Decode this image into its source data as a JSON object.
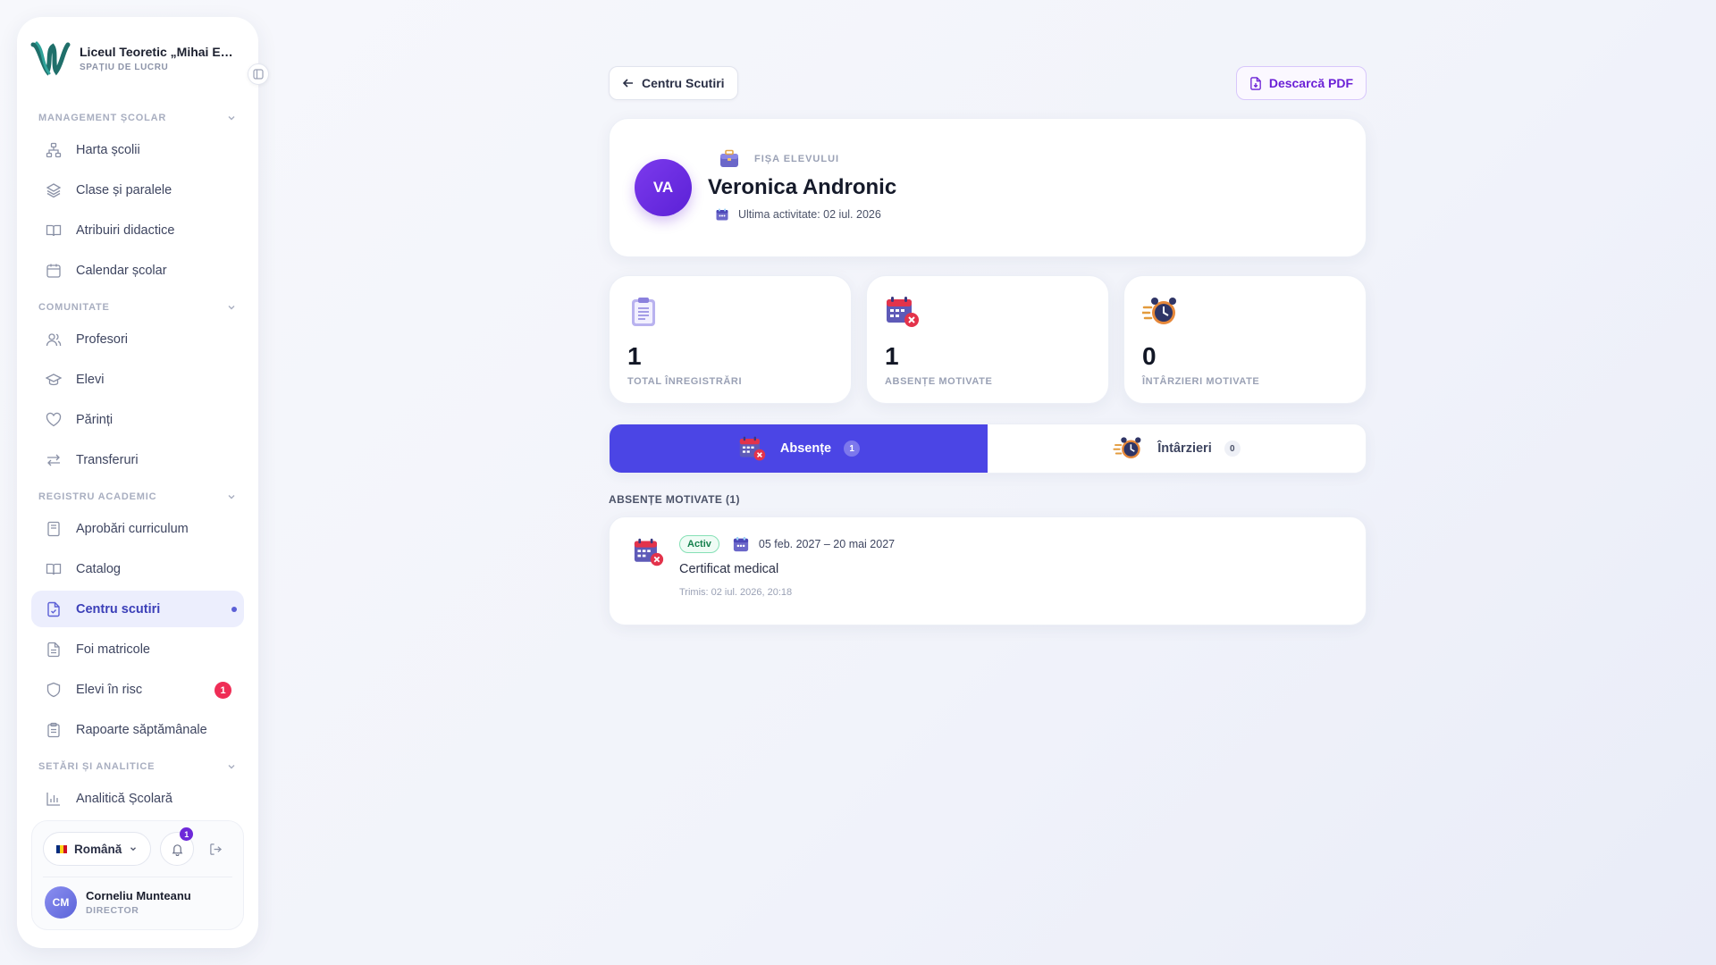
{
  "sidebar": {
    "school_name": "Liceul Teoretic „Mihai Eminescu”",
    "school_name_shown": "Liceul Teoretic „Mihai Emi...",
    "workspace_label": "SPAȚIU DE LUCRU",
    "sections": [
      {
        "label": "MANAGEMENT ȘCOLAR",
        "items": [
          {
            "label": "Harta școlii",
            "icon": "sitemap-icon"
          },
          {
            "label": "Clase și paralele",
            "icon": "layers-icon"
          },
          {
            "label": "Atribuiri didactice",
            "icon": "book-open-icon"
          },
          {
            "label": "Calendar școlar",
            "icon": "calendar-icon"
          }
        ]
      },
      {
        "label": "COMUNITATE",
        "items": [
          {
            "label": "Profesori",
            "icon": "users-icon"
          },
          {
            "label": "Elevi",
            "icon": "graduation-cap-icon"
          },
          {
            "label": "Părinți",
            "icon": "heart-icon"
          },
          {
            "label": "Transferuri",
            "icon": "swap-arrows-icon"
          }
        ]
      },
      {
        "label": "REGISTRU ACADEMIC",
        "items": [
          {
            "label": "Aprobări curriculum",
            "icon": "book-icon"
          },
          {
            "label": "Catalog",
            "icon": "book-open-icon"
          },
          {
            "label": "Centru scutiri",
            "icon": "file-check-icon",
            "active": true
          },
          {
            "label": "Foi matricole",
            "icon": "file-text-icon"
          },
          {
            "label": "Elevi în risc",
            "icon": "shield-icon",
            "badge": "1"
          },
          {
            "label": "Rapoarte săptămânale",
            "icon": "clipboard-icon"
          }
        ]
      },
      {
        "label": "SETĂRI ȘI ANALITICE",
        "items": [
          {
            "label": "Analitică Școlară",
            "icon": "bar-chart-icon"
          }
        ]
      }
    ],
    "footer": {
      "language": "Română",
      "notifications_count": "1",
      "user_initials": "CM",
      "user_name": "Corneliu Munteanu",
      "user_role": "DIRECTOR"
    }
  },
  "topbar": {
    "back_label": "Centru Scutiri",
    "pdf_label": "Descarcă PDF"
  },
  "profile": {
    "kicker": "FIȘA ELEVULUI",
    "initials": "VA",
    "name": "Veronica Andronic",
    "last_activity": "Ultima activitate: 02 iul. 2026"
  },
  "stats": [
    {
      "value": "1",
      "label": "TOTAL ÎNREGISTRĂRI",
      "icon": "clipboard-icon"
    },
    {
      "value": "1",
      "label": "ABSENȚE MOTIVATE",
      "icon": "calendar-x-icon"
    },
    {
      "value": "0",
      "label": "ÎNTÂRZIERI MOTIVATE",
      "icon": "alarm-clock-icon"
    }
  ],
  "tabs": [
    {
      "label": "Absențe",
      "count": "1",
      "active": true
    },
    {
      "label": "Întârzieri",
      "count": "0",
      "active": false
    }
  ],
  "list": {
    "heading": "ABSENȚE MOTIVATE (1)",
    "entries": [
      {
        "status": "Activ",
        "dates": "05 feb. 2027 – 20 mai 2027",
        "reason": "Certificat medical",
        "sent": "Trimis: 02 iul. 2026, 20:18"
      }
    ]
  },
  "colors": {
    "accent": "#4b45e5",
    "avatar": "#6d28d9",
    "danger_badge": "#ef2d56",
    "status_green": "#15804d"
  }
}
